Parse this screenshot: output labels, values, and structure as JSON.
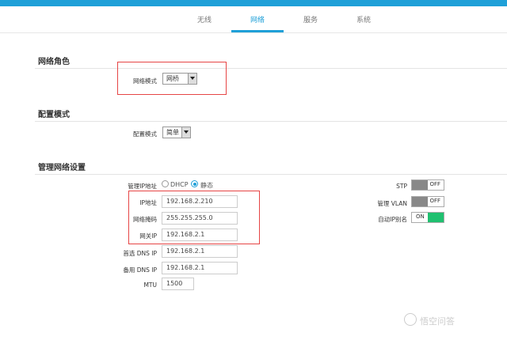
{
  "nav": {
    "tabs": [
      {
        "label": "无线",
        "active": false
      },
      {
        "label": "网络",
        "active": true
      },
      {
        "label": "服务",
        "active": false
      },
      {
        "label": "系统",
        "active": false
      }
    ]
  },
  "network_role": {
    "title": "网络角色",
    "mode_label": "网络模式",
    "mode_value": "网桥"
  },
  "config_mode": {
    "title": "配置模式",
    "mode_label": "配置模式",
    "mode_value": "简单"
  },
  "mgmt": {
    "title": "管理网络设置",
    "ip_addr_label": "管理IP地址",
    "dhcp_label": "DHCP",
    "static_label": "静态",
    "ip_label": "IP地址",
    "ip_value": "192.168.2.210",
    "mask_label": "网络掩码",
    "mask_value": "255.255.255.0",
    "gateway_label": "网关IP",
    "gateway_value": "192.168.2.1",
    "dns1_label": "首选 DNS IP",
    "dns1_value": "192.168.2.1",
    "dns2_label": "备用 DNS IP",
    "dns2_value": "192.168.2.1",
    "mtu_label": "MTU",
    "mtu_value": "1500",
    "stp_label": "STP",
    "stp_state": "OFF",
    "vlan_label": "管理 VLAN",
    "vlan_state": "OFF",
    "autoip_label": "自动IP别名",
    "autoip_state": "ON"
  },
  "colors": {
    "accent": "#1fa0d8",
    "on_green": "#20c070",
    "highlight_red": "#e64545"
  },
  "watermark": "悟空问答"
}
